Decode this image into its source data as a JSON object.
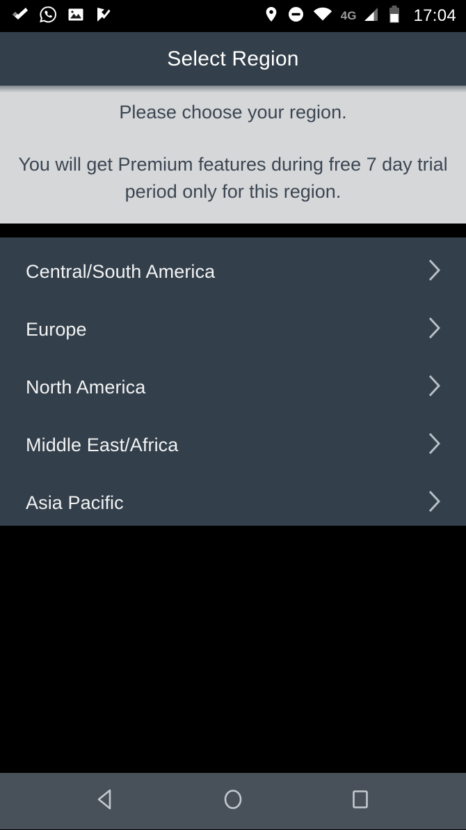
{
  "status_bar": {
    "time": "17:04",
    "network_label": "4G",
    "left_icons": [
      {
        "name": "checkmark-icon",
        "glyph": "check"
      },
      {
        "name": "whatsapp-icon",
        "glyph": "whatsapp"
      },
      {
        "name": "image-gallery-icon",
        "glyph": "image"
      },
      {
        "name": "task-check-icon",
        "glyph": "flag-check"
      }
    ],
    "right_icons": [
      {
        "name": "location-pin-icon",
        "glyph": "pin"
      },
      {
        "name": "do-not-disturb-icon",
        "glyph": "dnd"
      },
      {
        "name": "wifi-icon",
        "glyph": "wifi"
      },
      {
        "name": "cellular-signal-icon",
        "glyph": "signal"
      },
      {
        "name": "battery-icon",
        "glyph": "battery"
      }
    ]
  },
  "title_bar": {
    "title": "Select Region"
  },
  "instructions": {
    "line1": "Please choose your region.",
    "line2": "You will get Premium features during free 7 day trial period only for this region."
  },
  "region_list": {
    "items": [
      {
        "label": "Central/South America"
      },
      {
        "label": "Europe"
      },
      {
        "label": "North America"
      },
      {
        "label": "Middle East/Africa"
      },
      {
        "label": "Asia Pacific"
      }
    ],
    "chevron_icon": "chevron-right-icon"
  },
  "nav_bar": {
    "back_label": "Back",
    "home_label": "Home",
    "recents_label": "Recent apps"
  },
  "colors": {
    "status_bar_bg": "#000000",
    "title_bar_bg": "#333f4a",
    "instructions_bg": "#d6d7d9",
    "instructions_text": "#3b4652",
    "list_bg": "#333f4a",
    "list_text": "#f2f3f4",
    "chevron": "#b8bfc6",
    "nav_bar_bg": "#48515a",
    "nav_icon": "#c3c9cf",
    "accent_white": "#ffffff"
  }
}
